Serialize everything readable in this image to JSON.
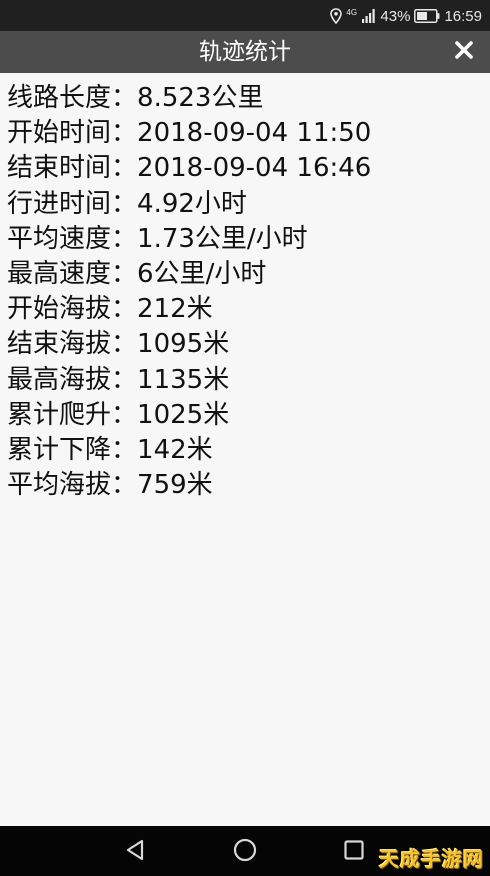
{
  "status_bar": {
    "network": "4G",
    "battery": "43%",
    "time": "16:59"
  },
  "header": {
    "title": "轨迹统计"
  },
  "stats": [
    {
      "label": "线路长度",
      "sep": "：",
      "value": "8.523公里"
    },
    {
      "label": "开始时间",
      "sep": "：",
      "value": "2018-09-04 11:50"
    },
    {
      "label": "结束时间",
      "sep": "：",
      "value": "2018-09-04 16:46"
    },
    {
      "label": "行进时间",
      "sep": "：",
      "value": "4.92小时"
    },
    {
      "label": "平均速度",
      "sep": "：",
      "value": "1.73公里/小时"
    },
    {
      "label": "最高速度",
      "sep": "：",
      "value": "6公里/小时"
    },
    {
      "label": "开始海拔",
      "sep": "：",
      "value": "212米"
    },
    {
      "label": "结束海拔",
      "sep": "：",
      "value": "1095米"
    },
    {
      "label": "最高海拔",
      "sep": "：",
      "value": "1135米"
    },
    {
      "label": "累计爬升",
      "sep": "：",
      "value": "1025米"
    },
    {
      "label": "累计下降",
      "sep": "：",
      "value": "142米"
    },
    {
      "label": "平均海拔",
      "sep": "：",
      "value": "759米"
    }
  ],
  "watermark": {
    "text": "天成手游网"
  },
  "colors": {
    "status_bar_bg": "#202020",
    "title_bar_bg": "#4c4c4c",
    "content_bg": "#f7f7f7",
    "nav_bar_bg": "#050505",
    "text": "#111111"
  },
  "icons": {
    "status": [
      "location-icon",
      "signal-icon",
      "battery-icon"
    ],
    "header": [
      "close-icon"
    ],
    "nav": [
      "back-icon",
      "home-icon",
      "recents-icon"
    ]
  }
}
